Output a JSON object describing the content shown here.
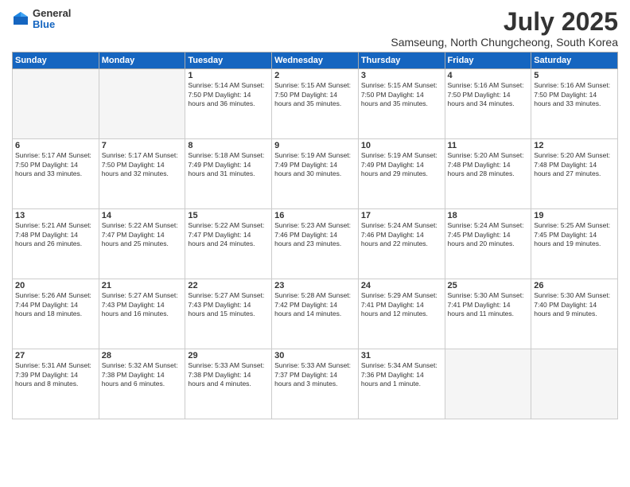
{
  "logo": {
    "general": "General",
    "blue": "Blue"
  },
  "title": "July 2025",
  "subtitle": "Samseung, North Chungcheong, South Korea",
  "days_of_week": [
    "Sunday",
    "Monday",
    "Tuesday",
    "Wednesday",
    "Thursday",
    "Friday",
    "Saturday"
  ],
  "weeks": [
    [
      {
        "day": "",
        "info": ""
      },
      {
        "day": "",
        "info": ""
      },
      {
        "day": "1",
        "info": "Sunrise: 5:14 AM\nSunset: 7:50 PM\nDaylight: 14 hours\nand 36 minutes."
      },
      {
        "day": "2",
        "info": "Sunrise: 5:15 AM\nSunset: 7:50 PM\nDaylight: 14 hours\nand 35 minutes."
      },
      {
        "day": "3",
        "info": "Sunrise: 5:15 AM\nSunset: 7:50 PM\nDaylight: 14 hours\nand 35 minutes."
      },
      {
        "day": "4",
        "info": "Sunrise: 5:16 AM\nSunset: 7:50 PM\nDaylight: 14 hours\nand 34 minutes."
      },
      {
        "day": "5",
        "info": "Sunrise: 5:16 AM\nSunset: 7:50 PM\nDaylight: 14 hours\nand 33 minutes."
      }
    ],
    [
      {
        "day": "6",
        "info": "Sunrise: 5:17 AM\nSunset: 7:50 PM\nDaylight: 14 hours\nand 33 minutes."
      },
      {
        "day": "7",
        "info": "Sunrise: 5:17 AM\nSunset: 7:50 PM\nDaylight: 14 hours\nand 32 minutes."
      },
      {
        "day": "8",
        "info": "Sunrise: 5:18 AM\nSunset: 7:49 PM\nDaylight: 14 hours\nand 31 minutes."
      },
      {
        "day": "9",
        "info": "Sunrise: 5:19 AM\nSunset: 7:49 PM\nDaylight: 14 hours\nand 30 minutes."
      },
      {
        "day": "10",
        "info": "Sunrise: 5:19 AM\nSunset: 7:49 PM\nDaylight: 14 hours\nand 29 minutes."
      },
      {
        "day": "11",
        "info": "Sunrise: 5:20 AM\nSunset: 7:48 PM\nDaylight: 14 hours\nand 28 minutes."
      },
      {
        "day": "12",
        "info": "Sunrise: 5:20 AM\nSunset: 7:48 PM\nDaylight: 14 hours\nand 27 minutes."
      }
    ],
    [
      {
        "day": "13",
        "info": "Sunrise: 5:21 AM\nSunset: 7:48 PM\nDaylight: 14 hours\nand 26 minutes."
      },
      {
        "day": "14",
        "info": "Sunrise: 5:22 AM\nSunset: 7:47 PM\nDaylight: 14 hours\nand 25 minutes."
      },
      {
        "day": "15",
        "info": "Sunrise: 5:22 AM\nSunset: 7:47 PM\nDaylight: 14 hours\nand 24 minutes."
      },
      {
        "day": "16",
        "info": "Sunrise: 5:23 AM\nSunset: 7:46 PM\nDaylight: 14 hours\nand 23 minutes."
      },
      {
        "day": "17",
        "info": "Sunrise: 5:24 AM\nSunset: 7:46 PM\nDaylight: 14 hours\nand 22 minutes."
      },
      {
        "day": "18",
        "info": "Sunrise: 5:24 AM\nSunset: 7:45 PM\nDaylight: 14 hours\nand 20 minutes."
      },
      {
        "day": "19",
        "info": "Sunrise: 5:25 AM\nSunset: 7:45 PM\nDaylight: 14 hours\nand 19 minutes."
      }
    ],
    [
      {
        "day": "20",
        "info": "Sunrise: 5:26 AM\nSunset: 7:44 PM\nDaylight: 14 hours\nand 18 minutes."
      },
      {
        "day": "21",
        "info": "Sunrise: 5:27 AM\nSunset: 7:43 PM\nDaylight: 14 hours\nand 16 minutes."
      },
      {
        "day": "22",
        "info": "Sunrise: 5:27 AM\nSunset: 7:43 PM\nDaylight: 14 hours\nand 15 minutes."
      },
      {
        "day": "23",
        "info": "Sunrise: 5:28 AM\nSunset: 7:42 PM\nDaylight: 14 hours\nand 14 minutes."
      },
      {
        "day": "24",
        "info": "Sunrise: 5:29 AM\nSunset: 7:41 PM\nDaylight: 14 hours\nand 12 minutes."
      },
      {
        "day": "25",
        "info": "Sunrise: 5:30 AM\nSunset: 7:41 PM\nDaylight: 14 hours\nand 11 minutes."
      },
      {
        "day": "26",
        "info": "Sunrise: 5:30 AM\nSunset: 7:40 PM\nDaylight: 14 hours\nand 9 minutes."
      }
    ],
    [
      {
        "day": "27",
        "info": "Sunrise: 5:31 AM\nSunset: 7:39 PM\nDaylight: 14 hours\nand 8 minutes."
      },
      {
        "day": "28",
        "info": "Sunrise: 5:32 AM\nSunset: 7:38 PM\nDaylight: 14 hours\nand 6 minutes."
      },
      {
        "day": "29",
        "info": "Sunrise: 5:33 AM\nSunset: 7:38 PM\nDaylight: 14 hours\nand 4 minutes."
      },
      {
        "day": "30",
        "info": "Sunrise: 5:33 AM\nSunset: 7:37 PM\nDaylight: 14 hours\nand 3 minutes."
      },
      {
        "day": "31",
        "info": "Sunrise: 5:34 AM\nSunset: 7:36 PM\nDaylight: 14 hours\nand 1 minute."
      },
      {
        "day": "",
        "info": ""
      },
      {
        "day": "",
        "info": ""
      }
    ]
  ]
}
